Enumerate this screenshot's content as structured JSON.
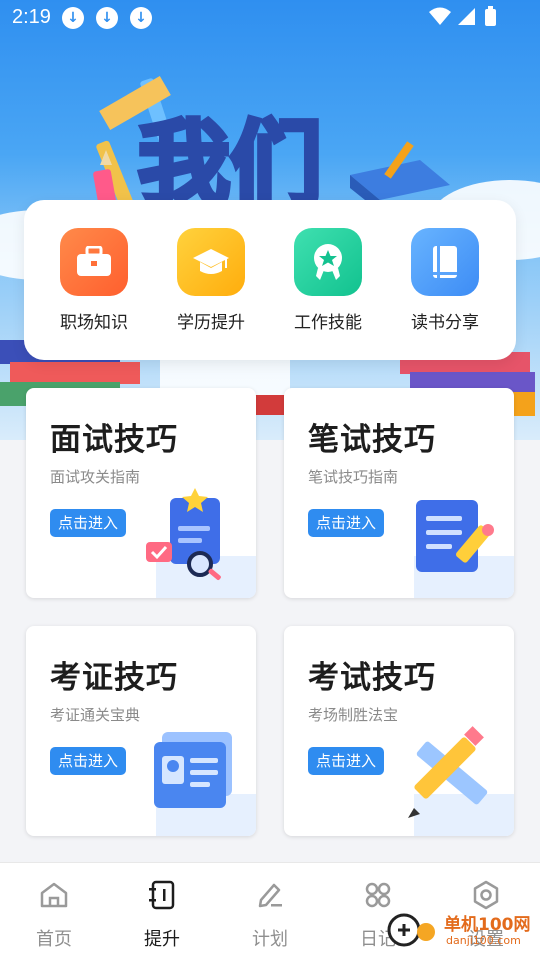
{
  "status": {
    "time": "2:19"
  },
  "hero": {
    "banner_text": "我们"
  },
  "categories": [
    {
      "label": "职场知识",
      "icon": "briefcase-icon",
      "color_from": "#ff8a4a",
      "color_to": "#ff5f2e"
    },
    {
      "label": "学历提升",
      "icon": "graduation-cap-icon",
      "color_from": "#ffd23d",
      "color_to": "#ffad0d"
    },
    {
      "label": "工作技能",
      "icon": "award-badge-icon",
      "color_from": "#3fe0b0",
      "color_to": "#12c28f"
    },
    {
      "label": "读书分享",
      "icon": "book-icon",
      "color_from": "#68b4ff",
      "color_to": "#3d8cf5"
    }
  ],
  "tiles": [
    {
      "title": "面试技巧",
      "subtitle": "面试攻关指南",
      "button": "点击进入",
      "icon": "resume-search-icon"
    },
    {
      "title": "笔试技巧",
      "subtitle": "笔试技巧指南",
      "button": "点击进入",
      "icon": "notebook-pen-icon"
    },
    {
      "title": "考证技巧",
      "subtitle": "考证通关宝典",
      "button": "点击进入",
      "icon": "id-card-icon"
    },
    {
      "title": "考试技巧",
      "subtitle": "考场制胜法宝",
      "button": "点击进入",
      "icon": "pencil-ruler-icon"
    }
  ],
  "tabs": [
    {
      "label": "首页",
      "icon": "home-icon",
      "active": false
    },
    {
      "label": "提升",
      "icon": "notebook-icon",
      "active": true
    },
    {
      "label": "计划",
      "icon": "edit-icon",
      "active": false
    },
    {
      "label": "日记",
      "icon": "grid-icon",
      "active": false
    },
    {
      "label": "设置",
      "icon": "settings-icon",
      "active": false
    }
  ],
  "watermark": {
    "title": "单机100网",
    "url": "danji100.com"
  },
  "colors": {
    "accent": "#2f8cf0",
    "hero_top": "#2f8ff0"
  }
}
